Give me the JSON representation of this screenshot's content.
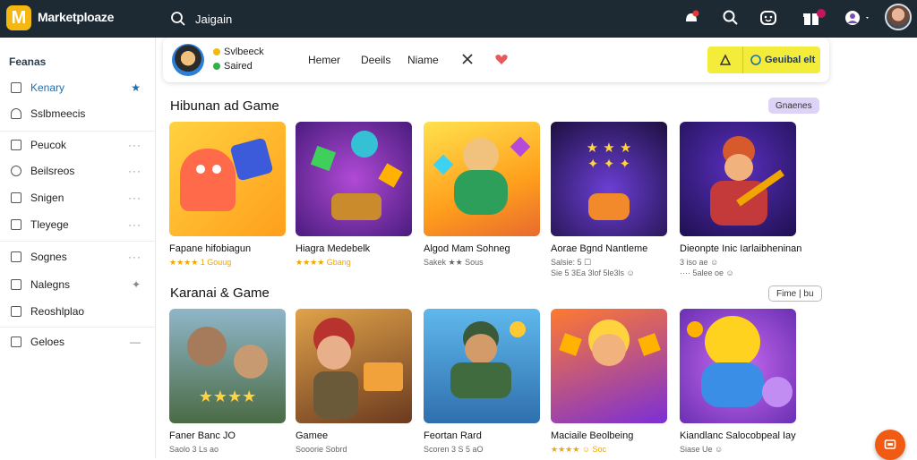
{
  "app": {
    "brand": "Marketploaze",
    "logo_letter": "M"
  },
  "search": {
    "value": "Jaigain",
    "placeholder": ""
  },
  "sidebar": {
    "heading": "Feanas",
    "items": [
      {
        "label": "Kenary",
        "trail": "★",
        "active": true
      },
      {
        "label": "Sslbmeecis",
        "trail": ""
      },
      {
        "label": "Peucok",
        "trail": "···"
      },
      {
        "label": "Beilsreos",
        "trail": "···"
      },
      {
        "label": "Snigen",
        "trail": "···"
      },
      {
        "label": "Tleyege",
        "trail": "···"
      },
      {
        "label": "Sognes",
        "trail": "···"
      },
      {
        "label": "Nalegns",
        "trail": "✦"
      },
      {
        "label": "Reoshlplao",
        "trail": ""
      },
      {
        "label": "Geloes",
        "trail": "—"
      }
    ]
  },
  "profile": {
    "name": "Svlbeeck",
    "status": "Saired",
    "nav": [
      "Hemer",
      "Deeils",
      "Niame"
    ],
    "action_label": "Geuibal elt"
  },
  "sections": [
    {
      "title": "Hibunan ad Game",
      "chip": "Gnaenes",
      "cards": [
        {
          "title": "Fapane hifobiagun",
          "meta": "★★★★ 1 Gouug",
          "meta2": ""
        },
        {
          "title": "Hiagra Medebelk",
          "meta": "★★★★ Gbang",
          "meta2": ""
        },
        {
          "title": "Algod Mam Sohneg",
          "meta": "Sakek ★★ Sous",
          "meta2": ""
        },
        {
          "title": "Aorae Bgnd Nantleme",
          "meta": "Salsie: 5 ☐",
          "meta2": "Sie 5 3Ea 3lof 5le3ls ☺"
        },
        {
          "title": "Dieonpte Inic Iarlaibheninan",
          "meta": "3 iso ae ☺",
          "meta2": "···· 5alee oe ☺"
        }
      ]
    },
    {
      "title": "Karanai & Game",
      "chip": "Fime | bu",
      "cards": [
        {
          "title": "Faner Banc JO",
          "meta": "Saolo 3 Ls ao",
          "meta2": ""
        },
        {
          "title": "Gamee",
          "meta": "Sooorie Sobrd",
          "meta2": ""
        },
        {
          "title": "Feortan Rard",
          "meta": "Scoren 3 S 5 aO",
          "meta2": ""
        },
        {
          "title": "Maciaile Beolbeing",
          "meta": "★★★★ ☺ Soc",
          "meta2": ""
        },
        {
          "title": "Kiandlanc Salocobpeal Iay",
          "meta": "Siase Ue ☺",
          "meta2": ""
        }
      ]
    }
  ],
  "colors": {
    "topbar": "#1e2a33",
    "accent": "#1a6fb5",
    "action_yellow": "#f4ec3a",
    "fab": "#f05a12"
  },
  "icons": [
    "search-icon",
    "bell-icon",
    "magnifier-icon",
    "smiley-icon",
    "gift-icon",
    "user-menu-icon",
    "star-icon",
    "close-icon",
    "heart-icon",
    "lock-icon",
    "globe-icon",
    "chat-icon"
  ]
}
